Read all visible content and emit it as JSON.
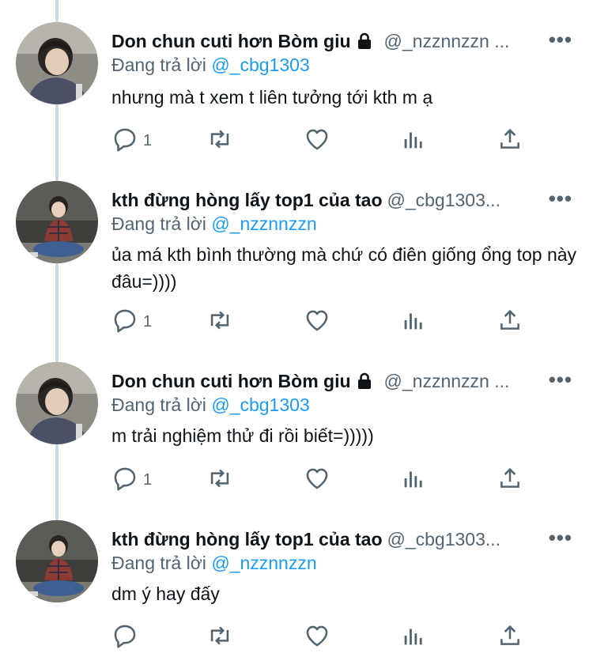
{
  "replying_label": "Đang trả lời",
  "more_glyph": "•••",
  "colors": {
    "accent": "#1d9bf0",
    "muted": "#536471",
    "text": "#0f1419",
    "thread_line": "#cfd9de"
  },
  "icons": {
    "reply": "speech-bubble-icon",
    "retweet": "retweet-arrows-icon",
    "like": "heart-icon",
    "views": "bar-chart-icon",
    "share": "share-upload-icon",
    "lock": "lock-icon"
  },
  "tweets": [
    {
      "name": "Don chun cuti hơn Bòm giu",
      "locked": true,
      "handle": "@_nzznnzzn ...",
      "reply_to": "@_cbg1303",
      "text": "nhưng mà t xem t liên tưởng tới kth m ạ",
      "reply_count": "1"
    },
    {
      "name": "kth đừng hòng lấy top1 của tao",
      "locked": false,
      "handle": "@_cbg1303...",
      "reply_to": "@_nzznnzzn",
      "text": "ủa má kth bình thường mà chứ có điên giống ổng top này đâu=))))",
      "reply_count": "1"
    },
    {
      "name": "Don chun cuti hơn Bòm giu",
      "locked": true,
      "handle": "@_nzznnzzn ...",
      "reply_to": "@_cbg1303",
      "text": "m trải nghiệm thử đi rồi biết=)))))",
      "reply_count": "1"
    },
    {
      "name": "kth đừng hòng lấy top1 của tao",
      "locked": false,
      "handle": "@_cbg1303...",
      "reply_to": "@_nzznnzzn",
      "text": "dm ý hay đấy",
      "reply_count": ""
    }
  ]
}
